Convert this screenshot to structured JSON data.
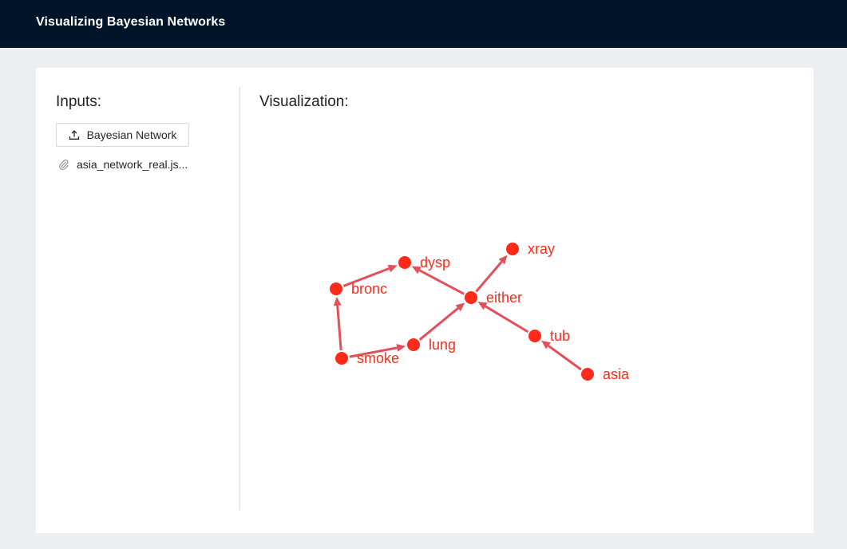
{
  "header": {
    "title": "Visualizing Bayesian Networks"
  },
  "inputs": {
    "title": "Inputs:",
    "upload_label": "Bayesian Network",
    "file_name": "asia_network_real.js..."
  },
  "visualization": {
    "title": "Visualization:",
    "colors": {
      "node": "#ff2a1a",
      "edge": "#e2505a"
    },
    "nodes": [
      {
        "id": "asia",
        "label": "asia"
      },
      {
        "id": "tub",
        "label": "tub"
      },
      {
        "id": "either",
        "label": "either"
      },
      {
        "id": "xray",
        "label": "xray"
      },
      {
        "id": "dysp",
        "label": "dysp"
      },
      {
        "id": "bronc",
        "label": "bronc"
      },
      {
        "id": "smoke",
        "label": "smoke"
      },
      {
        "id": "lung",
        "label": "lung"
      }
    ],
    "edges": [
      {
        "from": "asia",
        "to": "tub"
      },
      {
        "from": "tub",
        "to": "either"
      },
      {
        "from": "either",
        "to": "xray"
      },
      {
        "from": "either",
        "to": "dysp"
      },
      {
        "from": "lung",
        "to": "either"
      },
      {
        "from": "smoke",
        "to": "lung"
      },
      {
        "from": "smoke",
        "to": "bronc"
      },
      {
        "from": "bronc",
        "to": "dysp"
      }
    ]
  }
}
